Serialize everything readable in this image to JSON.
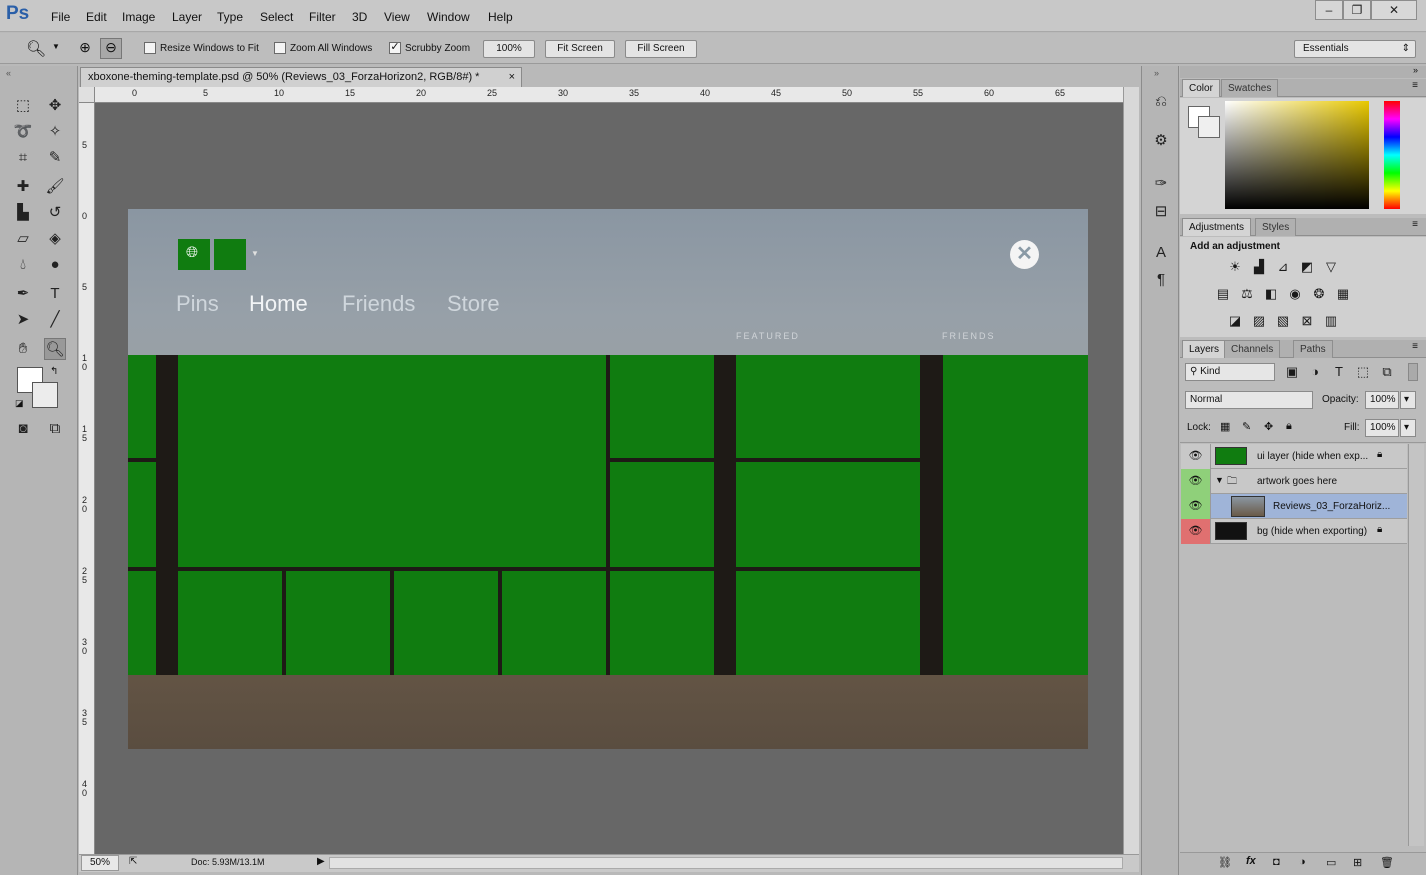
{
  "app": {
    "logo": "Ps",
    "menus": [
      "File",
      "Edit",
      "Image",
      "Layer",
      "Type",
      "Select",
      "Filter",
      "3D",
      "View",
      "Window",
      "Help"
    ],
    "window_buttons": [
      "–",
      "❐",
      "✕"
    ]
  },
  "options": {
    "resize_windows": "Resize Windows to Fit",
    "zoom_all": "Zoom All Windows",
    "scrubby": "Scrubby Zoom",
    "zoom_value": "100%",
    "fit_screen": "Fit Screen",
    "fill_screen": "Fill Screen",
    "workspace": "Essentials",
    "resize_checked": false,
    "zoom_all_checked": false,
    "scrubby_checked": true
  },
  "document": {
    "tab_title": "xboxone-theming-template.psd @ 50% (Reviews_03_ForzaHorizon2, RGB/8#) *",
    "close": "×",
    "zoom": "50%",
    "doc_size": "Doc: 5.93M/13.1M"
  },
  "ruler": {
    "h": [
      "0",
      "5",
      "10",
      "15",
      "20",
      "25",
      "30",
      "35",
      "40",
      "45",
      "50",
      "55",
      "60",
      "65"
    ],
    "v": [
      "5",
      "0",
      "5",
      "1 0",
      "1 5",
      "2 0",
      "2 5",
      "3 0",
      "3 5",
      "4 0"
    ]
  },
  "canvas": {
    "nav": [
      "Pins",
      "Home",
      "Friends",
      "Store"
    ],
    "sections": [
      "FEATURED",
      "FRIENDS"
    ]
  },
  "panels": {
    "color_tabs": [
      "Color",
      "Swatches"
    ],
    "adjust_tabs": [
      "Adjustments",
      "Styles"
    ],
    "add_adjustment": "Add an adjustment",
    "layers_tabs": [
      "Layers",
      "Channels",
      "Paths"
    ],
    "kind": "Kind",
    "blend": "Normal",
    "opacity_label": "Opacity:",
    "opacity": "100%",
    "lock_label": "Lock:",
    "fill_label": "Fill:",
    "fill": "100%",
    "layers": [
      {
        "name": "ui layer (hide when exp...",
        "eye": "👁"
      },
      {
        "name": "artwork goes here",
        "eye": "👁"
      },
      {
        "name": "Reviews_03_ForzaHoriz...",
        "eye": "👁"
      },
      {
        "name": "bg (hide when exporting)",
        "eye": "👁"
      }
    ]
  },
  "colors": {
    "tile_green": "#107c10",
    "eye_green": "#8fd07a",
    "eye_red": "#e07070",
    "selected_layer": "#9fb4d8"
  }
}
